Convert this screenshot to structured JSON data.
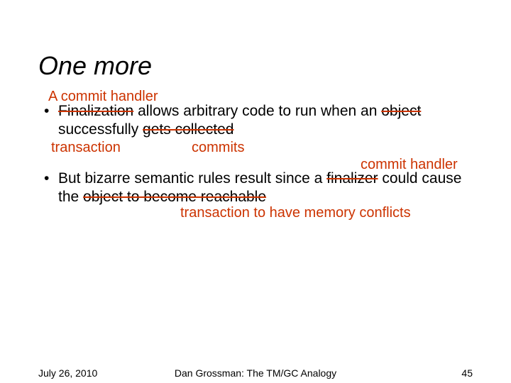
{
  "title": "One more",
  "bullet1": {
    "strike1": "Finalization",
    "mid1": " allows arbitrary code to run when an ",
    "strike2": "object",
    "mid2": " successfully ",
    "strike3": "gets collected"
  },
  "bullet2": {
    "lead": "But bizarre semantic rules result since a ",
    "strike1": "finalizer",
    "mid": " could cause the ",
    "strike2": "object to become reachable"
  },
  "annot": {
    "a_commit_handler": "A commit handler",
    "transaction": "transaction",
    "commits": "commits",
    "commit_handler": "commit handler",
    "transaction_conflicts": "transaction to have memory conflicts"
  },
  "footer": {
    "date": "July 26, 2010",
    "center": "Dan Grossman: The TM/GC Analogy",
    "page": "45"
  }
}
